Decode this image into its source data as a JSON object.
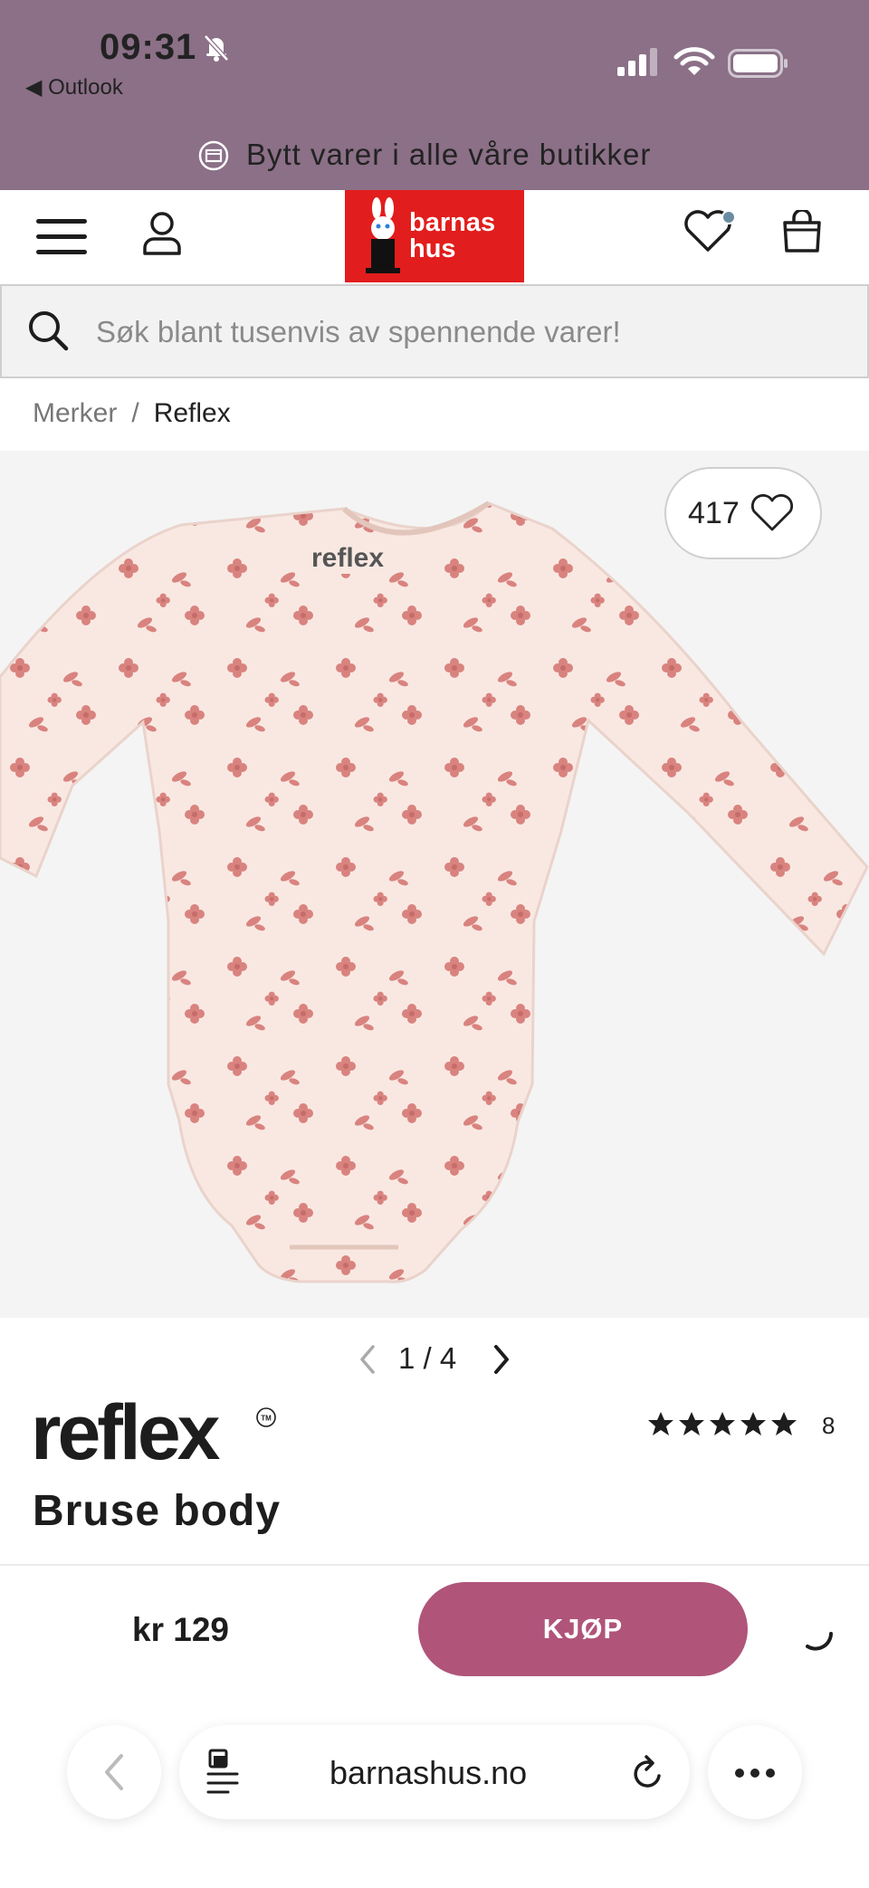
{
  "status_bar": {
    "time": "09:31",
    "back_app": "◀ Outlook",
    "background": "#8b7087"
  },
  "promo": {
    "text": "Bytt varer i alle våre butikker",
    "icon": "exchange-icon"
  },
  "header": {
    "logo_line1": "barnas",
    "logo_line2": "hus",
    "logo_color": "#e21d1d",
    "icons": [
      "menu-icon",
      "user-icon",
      "heart-icon",
      "bag-icon"
    ]
  },
  "search": {
    "placeholder": "Søk blant tusenvis av spennende varer!"
  },
  "breadcrumb": {
    "items": [
      "Merker",
      "Reflex"
    ],
    "separator": "/"
  },
  "gallery": {
    "likes": "417",
    "current": 1,
    "total": 4,
    "pager_text": "1 / 4",
    "garment_label": "reflex"
  },
  "product": {
    "brand": "reflex",
    "title": "Bruse body",
    "rating": 5,
    "review_count": "8",
    "price": "kr 129",
    "buy_label": "KJØP",
    "accent": "#b0547a"
  },
  "browser": {
    "url": "barnashus.no",
    "icons": [
      "back-icon",
      "reader-icon",
      "reload-icon",
      "more-icon"
    ]
  }
}
